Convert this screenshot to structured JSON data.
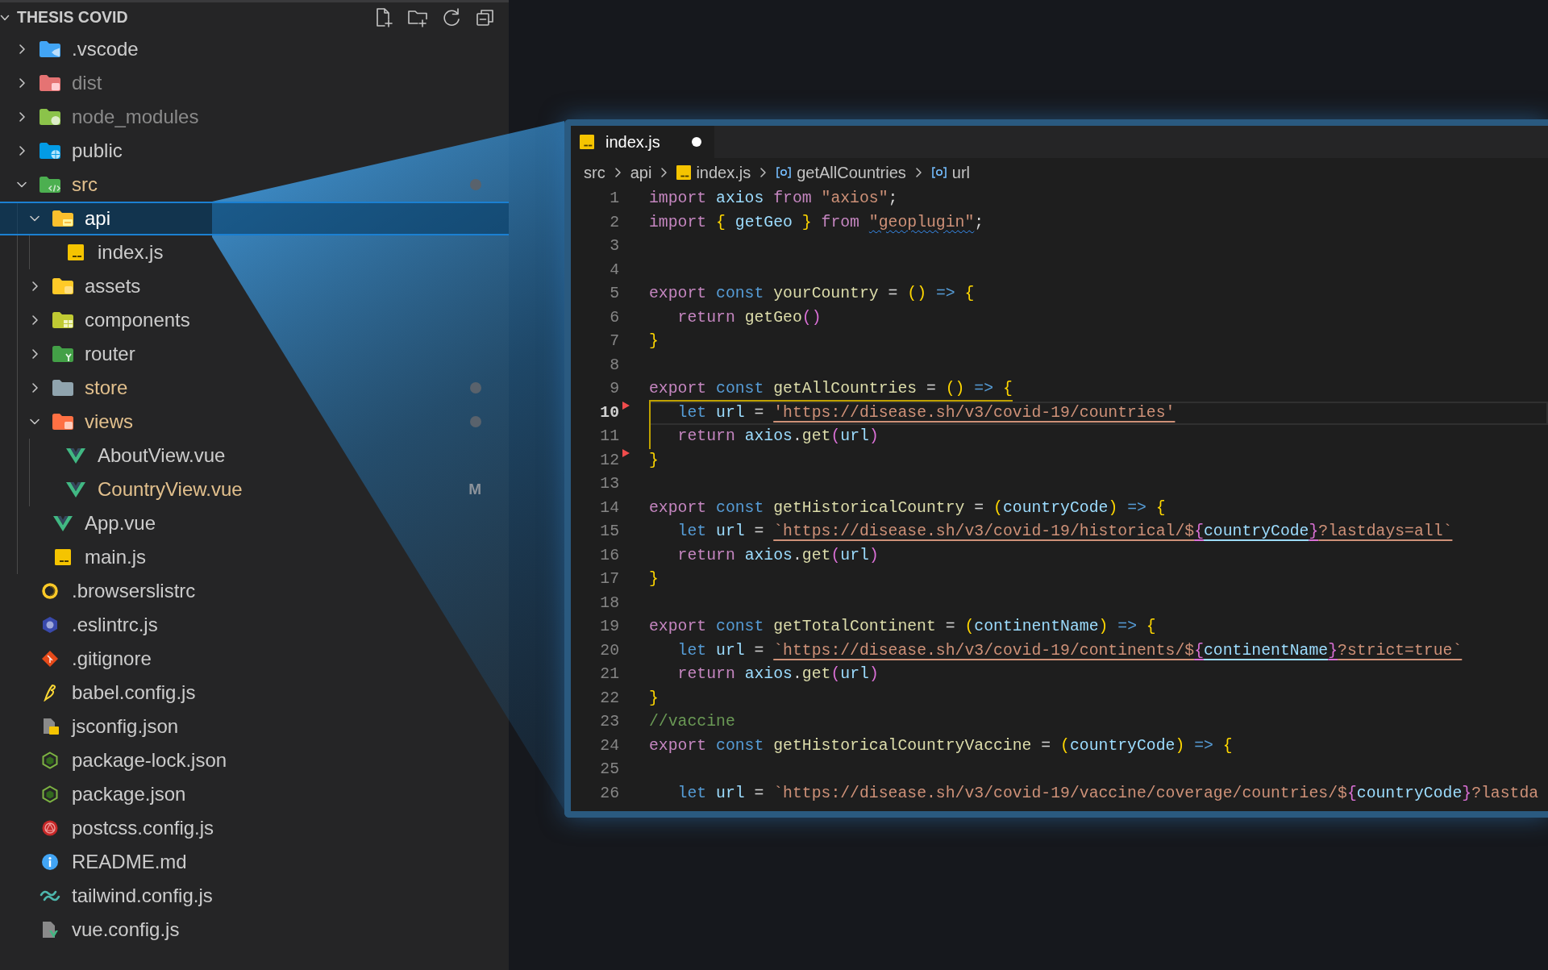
{
  "explorer": {
    "title": "THESIS COVID",
    "expanded": true,
    "items": [
      {
        "name": ".vscode",
        "kind": "vscode",
        "expanded": false,
        "selected": false,
        "ignored": false,
        "modified": false
      },
      {
        "name": "dist",
        "kind": "dist",
        "expanded": false,
        "selected": false,
        "ignored": true,
        "modified": false
      },
      {
        "name": "node_modules",
        "kind": "node",
        "expanded": false,
        "selected": false,
        "ignored": true,
        "modified": false
      },
      {
        "name": "public",
        "kind": "public",
        "expanded": false,
        "selected": false,
        "ignored": false,
        "modified": false
      },
      {
        "name": "src",
        "kind": "src",
        "expanded": true,
        "selected": false,
        "ignored": false,
        "modified": true,
        "children": [
          {
            "name": "api",
            "kind": "api",
            "expanded": true,
            "selected": true,
            "ignored": false,
            "modified": false,
            "children": [
              {
                "name": "index.js",
                "kind": "js",
                "selected": false,
                "ignored": false,
                "modified": false
              }
            ]
          },
          {
            "name": "assets",
            "kind": "assets",
            "expanded": false,
            "selected": false,
            "ignored": false,
            "modified": false
          },
          {
            "name": "components",
            "kind": "components",
            "expanded": false,
            "selected": false,
            "ignored": false,
            "modified": false
          },
          {
            "name": "router",
            "kind": "router",
            "expanded": false,
            "selected": false,
            "ignored": false,
            "modified": false
          },
          {
            "name": "store",
            "kind": "store",
            "expanded": false,
            "selected": false,
            "ignored": false,
            "modified": true
          },
          {
            "name": "views",
            "kind": "views",
            "expanded": true,
            "selected": false,
            "ignored": false,
            "modified": true,
            "children": [
              {
                "name": "AboutView.vue",
                "kind": "vue",
                "selected": false,
                "ignored": false,
                "modified": false
              },
              {
                "name": "CountryView.vue",
                "kind": "vue",
                "selected": false,
                "ignored": false,
                "modified": true,
                "badge": "M"
              }
            ]
          },
          {
            "name": "App.vue",
            "kind": "vue",
            "selected": false,
            "ignored": false,
            "modified": false
          },
          {
            "name": "main.js",
            "kind": "js",
            "selected": false,
            "ignored": false,
            "modified": false
          }
        ]
      },
      {
        "name": ".browserslistrc",
        "kind": "browserslist",
        "selected": false,
        "ignored": false,
        "modified": false
      },
      {
        "name": ".eslintrc.js",
        "kind": "eslint",
        "selected": false,
        "ignored": false,
        "modified": false
      },
      {
        "name": ".gitignore",
        "kind": "git",
        "selected": false,
        "ignored": false,
        "modified": false
      },
      {
        "name": "babel.config.js",
        "kind": "babel",
        "selected": false,
        "ignored": false,
        "modified": false
      },
      {
        "name": "jsconfig.json",
        "kind": "jsconfig",
        "selected": false,
        "ignored": false,
        "modified": false
      },
      {
        "name": "package-lock.json",
        "kind": "npm",
        "selected": false,
        "ignored": false,
        "modified": false
      },
      {
        "name": "package.json",
        "kind": "npm",
        "selected": false,
        "ignored": false,
        "modified": false
      },
      {
        "name": "postcss.config.js",
        "kind": "postcss",
        "selected": false,
        "ignored": false,
        "modified": false
      },
      {
        "name": "README.md",
        "kind": "readme",
        "selected": false,
        "ignored": false,
        "modified": false
      },
      {
        "name": "tailwind.config.js",
        "kind": "tailwind",
        "selected": false,
        "ignored": false,
        "modified": false
      },
      {
        "name": "vue.config.js",
        "kind": "vueconfig",
        "selected": false,
        "ignored": false,
        "modified": false
      }
    ]
  },
  "editor": {
    "tabs": [
      {
        "label": "index.js",
        "kind": "js",
        "selected": true,
        "modified": true
      }
    ],
    "breadcrumbs": [
      {
        "text": "src",
        "kind": "folder"
      },
      {
        "text": "api",
        "kind": "folder"
      },
      {
        "text": "index.js",
        "kind": "js"
      },
      {
        "text": "getAllCountries",
        "kind": "symbol"
      },
      {
        "text": "url",
        "kind": "symbol"
      }
    ],
    "lines": [
      {
        "number": "1",
        "current": false,
        "deleted_above": false,
        "tokens": [
          {
            "text": "import ",
            "kind": "keyword"
          },
          {
            "text": "axios ",
            "kind": "variable"
          },
          {
            "text": "from ",
            "kind": "keyword"
          },
          {
            "text": "\"axios\"",
            "kind": "string"
          },
          {
            "text": ";",
            "kind": "plain"
          }
        ]
      },
      {
        "number": "2",
        "current": false,
        "deleted_above": false,
        "tokens": [
          {
            "text": "import ",
            "kind": "keyword"
          },
          {
            "text": "{",
            "kind": "bracket1"
          },
          {
            "text": " getGeo ",
            "kind": "variable"
          },
          {
            "text": "}",
            "kind": "bracket1"
          },
          {
            "text": " from ",
            "kind": "keyword"
          },
          {
            "text": "\"geoplugin\"",
            "kind": "string",
            "squiggle": true
          },
          {
            "text": ";",
            "kind": "plain"
          }
        ]
      },
      {
        "number": "3",
        "current": false,
        "deleted_above": false
      },
      {
        "number": "4",
        "current": false,
        "deleted_above": false
      },
      {
        "number": "5",
        "current": false,
        "deleted_above": false,
        "tokens": [
          {
            "text": "export ",
            "kind": "keyword"
          },
          {
            "text": "const ",
            "kind": "storage"
          },
          {
            "text": "yourCountry",
            "kind": "function"
          },
          {
            "text": " = ",
            "kind": "plain"
          },
          {
            "text": "()",
            "kind": "bracket1"
          },
          {
            "text": " => ",
            "kind": "storage"
          },
          {
            "text": "{",
            "kind": "bracket1"
          }
        ]
      },
      {
        "number": "6",
        "current": false,
        "deleted_above": false,
        "tokens": [
          {
            "text": "   return ",
            "kind": "keyword"
          },
          {
            "text": "getGeo",
            "kind": "function"
          },
          {
            "text": "()",
            "kind": "bracket2"
          }
        ]
      },
      {
        "number": "7",
        "current": false,
        "deleted_above": false,
        "tokens": [
          {
            "text": "}",
            "kind": "bracket1"
          }
        ]
      },
      {
        "number": "8",
        "current": false,
        "deleted_above": false
      },
      {
        "number": "9",
        "current": false,
        "deleted_above": false,
        "guide_below": true,
        "tokens": [
          {
            "text": "export ",
            "kind": "keyword"
          },
          {
            "text": "const ",
            "kind": "storage"
          },
          {
            "text": "getAllCountries",
            "kind": "function"
          },
          {
            "text": " = ",
            "kind": "plain"
          },
          {
            "text": "()",
            "kind": "bracket1"
          },
          {
            "text": " => ",
            "kind": "storage"
          },
          {
            "text": "{",
            "kind": "bracket1"
          }
        ]
      },
      {
        "number": "10",
        "current": true,
        "deleted_above": true,
        "guide_left": true,
        "tokens": [
          {
            "text": "   let ",
            "kind": "storage"
          },
          {
            "text": "url",
            "kind": "variable"
          },
          {
            "text": " = ",
            "kind": "plain"
          },
          {
            "text": "'https://disease.sh/v3/covid-19/countries'",
            "kind": "string",
            "underlined": true
          }
        ]
      },
      {
        "number": "11",
        "current": false,
        "deleted_above": false,
        "guide_left": true,
        "tokens": [
          {
            "text": "   return ",
            "kind": "keyword"
          },
          {
            "text": "axios",
            "kind": "variable"
          },
          {
            "text": ".",
            "kind": "plain"
          },
          {
            "text": "get",
            "kind": "function"
          },
          {
            "text": "(",
            "kind": "bracket2"
          },
          {
            "text": "url",
            "kind": "variable"
          },
          {
            "text": ")",
            "kind": "bracket2"
          }
        ]
      },
      {
        "number": "12",
        "current": false,
        "deleted_above": true,
        "tokens": [
          {
            "text": "}",
            "kind": "bracket1"
          }
        ]
      },
      {
        "number": "13",
        "current": false,
        "deleted_above": false
      },
      {
        "number": "14",
        "current": false,
        "deleted_above": false,
        "tokens": [
          {
            "text": "export ",
            "kind": "keyword"
          },
          {
            "text": "const ",
            "kind": "storage"
          },
          {
            "text": "getHistoricalCountry",
            "kind": "function"
          },
          {
            "text": " = ",
            "kind": "plain"
          },
          {
            "text": "(",
            "kind": "bracket1"
          },
          {
            "text": "countryCode",
            "kind": "variable"
          },
          {
            "text": ")",
            "kind": "bracket1"
          },
          {
            "text": " => ",
            "kind": "storage"
          },
          {
            "text": "{",
            "kind": "bracket1"
          }
        ]
      },
      {
        "number": "15",
        "current": false,
        "deleted_above": false,
        "tokens": [
          {
            "text": "   let ",
            "kind": "storage"
          },
          {
            "text": "url",
            "kind": "variable"
          },
          {
            "text": " = ",
            "kind": "plain"
          },
          {
            "text": "`https://disease.sh/v3/covid-19/historical/$",
            "kind": "string",
            "underlined": true
          },
          {
            "text": "{",
            "kind": "bracket2",
            "underlined": true
          },
          {
            "text": "countryCode",
            "kind": "variable",
            "underlined": true
          },
          {
            "text": "}",
            "kind": "bracket2",
            "underlined": true
          },
          {
            "text": "?lastdays=all`",
            "kind": "string",
            "underlined": true
          }
        ]
      },
      {
        "number": "16",
        "current": false,
        "deleted_above": false,
        "tokens": [
          {
            "text": "   return ",
            "kind": "keyword"
          },
          {
            "text": "axios",
            "kind": "variable"
          },
          {
            "text": ".",
            "kind": "plain"
          },
          {
            "text": "get",
            "kind": "function"
          },
          {
            "text": "(",
            "kind": "bracket2"
          },
          {
            "text": "url",
            "kind": "variable"
          },
          {
            "text": ")",
            "kind": "bracket2"
          }
        ]
      },
      {
        "number": "17",
        "current": false,
        "deleted_above": false,
        "tokens": [
          {
            "text": "}",
            "kind": "bracket1"
          }
        ]
      },
      {
        "number": "18",
        "current": false,
        "deleted_above": false
      },
      {
        "number": "19",
        "current": false,
        "deleted_above": false,
        "tokens": [
          {
            "text": "export ",
            "kind": "keyword"
          },
          {
            "text": "const ",
            "kind": "storage"
          },
          {
            "text": "getTotalContinent",
            "kind": "function"
          },
          {
            "text": " = ",
            "kind": "plain"
          },
          {
            "text": "(",
            "kind": "bracket1"
          },
          {
            "text": "continentName",
            "kind": "variable"
          },
          {
            "text": ")",
            "kind": "bracket1"
          },
          {
            "text": " => ",
            "kind": "storage"
          },
          {
            "text": "{",
            "kind": "bracket1"
          }
        ]
      },
      {
        "number": "20",
        "current": false,
        "deleted_above": false,
        "tokens": [
          {
            "text": "   let ",
            "kind": "storage"
          },
          {
            "text": "url",
            "kind": "variable"
          },
          {
            "text": " = ",
            "kind": "plain"
          },
          {
            "text": "`https://disease.sh/v3/covid-19/continents/$",
            "kind": "string",
            "underlined": true
          },
          {
            "text": "{",
            "kind": "bracket2",
            "underlined": true
          },
          {
            "text": "continentName",
            "kind": "variable",
            "underlined": true
          },
          {
            "text": "}",
            "kind": "bracket2",
            "underlined": true
          },
          {
            "text": "?strict=true`",
            "kind": "string",
            "underlined": true
          }
        ]
      },
      {
        "number": "21",
        "current": false,
        "deleted_above": false,
        "tokens": [
          {
            "text": "   return ",
            "kind": "keyword"
          },
          {
            "text": "axios",
            "kind": "variable"
          },
          {
            "text": ".",
            "kind": "plain"
          },
          {
            "text": "get",
            "kind": "function"
          },
          {
            "text": "(",
            "kind": "bracket2"
          },
          {
            "text": "url",
            "kind": "variable"
          },
          {
            "text": ")",
            "kind": "bracket2"
          }
        ]
      },
      {
        "number": "22",
        "current": false,
        "deleted_above": false,
        "tokens": [
          {
            "text": "}",
            "kind": "bracket1"
          }
        ]
      },
      {
        "number": "23",
        "current": false,
        "deleted_above": false,
        "tokens": [
          {
            "text": "//vaccine",
            "kind": "comment"
          }
        ]
      },
      {
        "number": "24",
        "current": false,
        "deleted_above": false,
        "tokens": [
          {
            "text": "export ",
            "kind": "keyword"
          },
          {
            "text": "const ",
            "kind": "storage"
          },
          {
            "text": "getHistoricalCountryVaccine",
            "kind": "function"
          },
          {
            "text": " = ",
            "kind": "plain"
          },
          {
            "text": "(",
            "kind": "bracket1"
          },
          {
            "text": "countryCode",
            "kind": "variable"
          },
          {
            "text": ")",
            "kind": "bracket1"
          },
          {
            "text": " => ",
            "kind": "storage"
          },
          {
            "text": "{",
            "kind": "bracket1"
          }
        ]
      },
      {
        "number": "25",
        "current": false,
        "deleted_above": false
      },
      {
        "number": "26",
        "current": false,
        "deleted_above": false,
        "tokens": [
          {
            "text": "   let ",
            "kind": "storage"
          },
          {
            "text": "url",
            "kind": "variable"
          },
          {
            "text": " = ",
            "kind": "plain"
          },
          {
            "text": "`https://disease.sh/v3/covid-19/vaccine/coverage/countries/$",
            "kind": "string"
          },
          {
            "text": "{",
            "kind": "bracket2"
          },
          {
            "text": "countryCode",
            "kind": "variable"
          },
          {
            "text": "}",
            "kind": "bracket2"
          },
          {
            "text": "?lastda",
            "kind": "string"
          }
        ]
      }
    ]
  }
}
